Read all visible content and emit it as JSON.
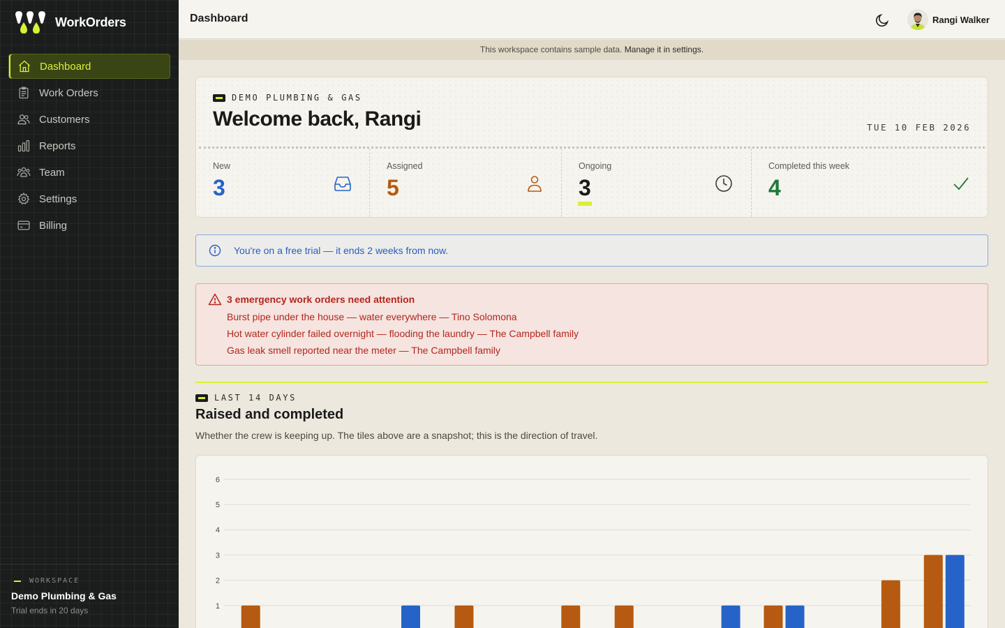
{
  "app": {
    "name": "WorkOrders"
  },
  "sidebar": {
    "items": [
      {
        "label": "Dashboard",
        "icon": "home-icon",
        "active": true
      },
      {
        "label": "Work Orders",
        "icon": "clipboard-icon"
      },
      {
        "label": "Customers",
        "icon": "users-icon"
      },
      {
        "label": "Reports",
        "icon": "bar-chart-icon"
      },
      {
        "label": "Team",
        "icon": "team-icon"
      },
      {
        "label": "Settings",
        "icon": "gear-icon"
      },
      {
        "label": "Billing",
        "icon": "credit-card-icon"
      }
    ],
    "workspace": {
      "label": "WORKSPACE",
      "name": "Demo Plumbing & Gas",
      "trial": "Trial ends in 20 days"
    }
  },
  "header": {
    "title": "Dashboard",
    "user_name": "Rangi Walker"
  },
  "sample_banner": {
    "text": "This workspace contains sample data.",
    "link": "Manage it in settings."
  },
  "welcome": {
    "org": "DEMO PLUMBING & GAS",
    "title": "Welcome back, Rangi",
    "date": "TUE 10 FEB 2026",
    "stats": [
      {
        "label": "New",
        "value": "3",
        "color": "#2563c9",
        "icon": "inbox-icon"
      },
      {
        "label": "Assigned",
        "value": "5",
        "color": "#b55a10",
        "icon": "user-icon"
      },
      {
        "label": "Ongoing",
        "value": "3",
        "color": "#1a1a1a",
        "icon": "clock-icon"
      },
      {
        "label": "Completed this week",
        "value": "4",
        "color": "#1f7a3a",
        "icon": "check-icon"
      }
    ]
  },
  "trial_banner": {
    "text": "You're on a free trial — it ends 2 weeks from now."
  },
  "emergency": {
    "title": "3 emergency work orders need attention",
    "items": [
      "Burst pipe under the house — water everywhere — Tino Solomona",
      "Hot water cylinder failed overnight — flooding the laundry — The Campbell family",
      "Gas leak smell reported near the meter — The Campbell family"
    ]
  },
  "section": {
    "kicker": "LAST 14 DAYS",
    "title": "Raised and completed",
    "description": "Whether the crew is keeping up. The tiles above are a snapshot; this is the direction of travel."
  },
  "chart_data": {
    "type": "bar",
    "ylim": [
      0,
      6
    ],
    "yticks": [
      1,
      2,
      3,
      4,
      5,
      6
    ],
    "grid": true,
    "categories": 14,
    "series": [
      {
        "color": "#b55a10",
        "values": [
          1,
          0,
          0,
          0,
          1,
          0,
          1,
          1,
          0,
          0,
          1,
          0,
          2,
          3
        ]
      },
      {
        "color": "#2563c9",
        "values": [
          0,
          0,
          0,
          1,
          0,
          0,
          0,
          0,
          0,
          1,
          1,
          0,
          0,
          3
        ]
      }
    ]
  }
}
